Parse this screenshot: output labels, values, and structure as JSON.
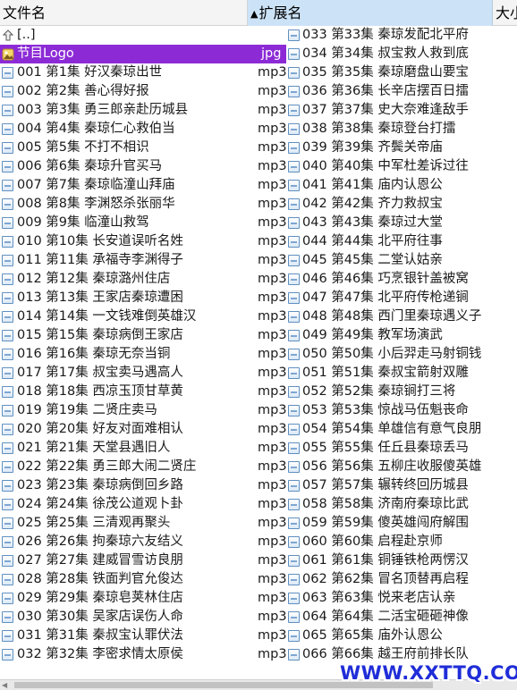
{
  "header": {
    "col_name": "文件名",
    "col_ext": "扩展名",
    "col_size": "大小",
    "sort_indicator": "arrow-up-icon"
  },
  "left_rows": [
    {
      "name": "[..]",
      "ext": "",
      "icon": "up-folder-icon"
    },
    {
      "name": "节目Logo",
      "ext": "jpg",
      "icon": "image-file-icon",
      "selected": true
    },
    {
      "name": "001 第1集 好汉秦琼出世",
      "ext": "mp3",
      "icon": "audio-file-icon"
    },
    {
      "name": "002 第2集 善心得好报",
      "ext": "mp3",
      "icon": "audio-file-icon"
    },
    {
      "name": "003 第3集 勇三郎亲赴历城县",
      "ext": "mp3",
      "icon": "audio-file-icon"
    },
    {
      "name": "004 第4集 秦琼仁心救伯当",
      "ext": "mp3",
      "icon": "audio-file-icon"
    },
    {
      "name": "005 第5集 不打不相识",
      "ext": "mp3",
      "icon": "audio-file-icon"
    },
    {
      "name": "006 第6集 秦琼升官买马",
      "ext": "mp3",
      "icon": "audio-file-icon"
    },
    {
      "name": "007 第7集 秦琼临潼山拜庙",
      "ext": "mp3",
      "icon": "audio-file-icon"
    },
    {
      "name": "008 第8集 李渊怒杀张丽华",
      "ext": "mp3",
      "icon": "audio-file-icon"
    },
    {
      "name": "009 第9集 临潼山救驾",
      "ext": "mp3",
      "icon": "audio-file-icon"
    },
    {
      "name": "010 第10集 长安道误听名姓",
      "ext": "mp3",
      "icon": "audio-file-icon"
    },
    {
      "name": "011 第11集 承福寺李渊得子",
      "ext": "mp3",
      "icon": "audio-file-icon"
    },
    {
      "name": "012 第12集 秦琼潞州住店",
      "ext": "mp3",
      "icon": "audio-file-icon"
    },
    {
      "name": "013 第13集 王家店秦琼遭困",
      "ext": "mp3",
      "icon": "audio-file-icon"
    },
    {
      "name": "014 第14集 一文钱难倒英雄汉",
      "ext": "mp3",
      "icon": "audio-file-icon"
    },
    {
      "name": "015 第15集 秦琼病倒王家店",
      "ext": "mp3",
      "icon": "audio-file-icon"
    },
    {
      "name": "016 第16集 秦琼无奈当铜",
      "ext": "mp3",
      "icon": "audio-file-icon"
    },
    {
      "name": "017 第17集 叔宝卖马遇高人",
      "ext": "mp3",
      "icon": "audio-file-icon"
    },
    {
      "name": "018 第18集 西凉玉顶甘草黄",
      "ext": "mp3",
      "icon": "audio-file-icon"
    },
    {
      "name": "019 第19集 二贤庄卖马",
      "ext": "mp3",
      "icon": "audio-file-icon"
    },
    {
      "name": "020 第20集 好友对面难相认",
      "ext": "mp3",
      "icon": "audio-file-icon"
    },
    {
      "name": "021 第21集 天堂县遇旧人",
      "ext": "mp3",
      "icon": "audio-file-icon"
    },
    {
      "name": "022 第22集 勇三郎大闹二贤庄",
      "ext": "mp3",
      "icon": "audio-file-icon"
    },
    {
      "name": "023 第23集 秦琼病倒回乡路",
      "ext": "mp3",
      "icon": "audio-file-icon"
    },
    {
      "name": "024 第24集 徐茂公道观卜卦",
      "ext": "mp3",
      "icon": "audio-file-icon"
    },
    {
      "name": "025 第25集 三清观再聚头",
      "ext": "mp3",
      "icon": "audio-file-icon"
    },
    {
      "name": "026 第26集 拘秦琼六友结义",
      "ext": "mp3",
      "icon": "audio-file-icon"
    },
    {
      "name": "027 第27集 建威冒雪访良朋",
      "ext": "mp3",
      "icon": "audio-file-icon"
    },
    {
      "name": "028 第28集 铁面判官允俊达",
      "ext": "mp3",
      "icon": "audio-file-icon"
    },
    {
      "name": "029 第29集 秦琼皂荚林住店",
      "ext": "mp3",
      "icon": "audio-file-icon"
    },
    {
      "name": "030 第30集 吴家店误伤人命",
      "ext": "mp3",
      "icon": "audio-file-icon"
    },
    {
      "name": "031 第31集 秦叔宝认罪伏法",
      "ext": "mp3",
      "icon": "audio-file-icon"
    },
    {
      "name": "032 第32集 李密求情太原侯",
      "ext": "mp3",
      "icon": "audio-file-icon"
    }
  ],
  "right_rows": [
    {
      "name": "033 第33集 秦琼发配北平府",
      "icon": "audio-file-icon"
    },
    {
      "name": "034 第34集 叔宝救人救到底",
      "icon": "audio-file-icon"
    },
    {
      "name": "035 第35集 秦琼磨盘山要宝",
      "icon": "audio-file-icon"
    },
    {
      "name": "036 第36集 长辛店摆百日擂",
      "icon": "audio-file-icon"
    },
    {
      "name": "037 第37集 史大奈难逢敌手",
      "icon": "audio-file-icon"
    },
    {
      "name": "038 第38集 秦琼登台打擂",
      "icon": "audio-file-icon"
    },
    {
      "name": "039 第39集 齐鬓关帝庙",
      "icon": "audio-file-icon"
    },
    {
      "name": "040 第40集 中军杜差诉过往",
      "icon": "audio-file-icon"
    },
    {
      "name": "041 第41集 庙内认恩公",
      "icon": "audio-file-icon"
    },
    {
      "name": "042 第42集 齐力救叔宝",
      "icon": "audio-file-icon"
    },
    {
      "name": "043 第43集 秦琼过大堂",
      "icon": "audio-file-icon"
    },
    {
      "name": "044 第44集 北平府往事",
      "icon": "audio-file-icon"
    },
    {
      "name": "045 第45集 二堂认姑亲",
      "icon": "audio-file-icon"
    },
    {
      "name": "046 第46集 巧烹银针盖被窝",
      "icon": "audio-file-icon"
    },
    {
      "name": "047 第47集 北平府传枪递锏",
      "icon": "audio-file-icon"
    },
    {
      "name": "048 第48集 西门里秦琼遇义子",
      "icon": "audio-file-icon"
    },
    {
      "name": "049 第49集 教军场演武",
      "icon": "audio-file-icon"
    },
    {
      "name": "050 第50集 小后羿走马射铜钱",
      "icon": "audio-file-icon"
    },
    {
      "name": "051 第51集 秦叔宝箭射双雕",
      "icon": "audio-file-icon"
    },
    {
      "name": "052 第52集 秦琼锏打三将",
      "icon": "audio-file-icon"
    },
    {
      "name": "053 第53集 惊战马伍魁丧命",
      "icon": "audio-file-icon"
    },
    {
      "name": "054 第54集 单雄信有意气良朋",
      "icon": "audio-file-icon"
    },
    {
      "name": "055 第55集 任丘县秦琼丢马",
      "icon": "audio-file-icon"
    },
    {
      "name": "056 第56集 五柳庄收服傻英雄",
      "icon": "audio-file-icon"
    },
    {
      "name": "057 第57集 辗转终回历城县",
      "icon": "audio-file-icon"
    },
    {
      "name": "058 第58集 济南府秦琼比武",
      "icon": "audio-file-icon"
    },
    {
      "name": "059 第59集 傻英雄闯府解围",
      "icon": "audio-file-icon"
    },
    {
      "name": "060 第60集 启程赴京师",
      "icon": "audio-file-icon"
    },
    {
      "name": "061 第61集 铜锤铁枪两愣汉",
      "icon": "audio-file-icon"
    },
    {
      "name": "062 第62集 冒名顶替再启程",
      "icon": "audio-file-icon"
    },
    {
      "name": "063 第63集 悦来老店认亲",
      "icon": "audio-file-icon"
    },
    {
      "name": "064 第64集 二活宝砸砸神像",
      "icon": "audio-file-icon"
    },
    {
      "name": "065 第65集 庙外认恩公",
      "icon": "audio-file-icon"
    },
    {
      "name": "066 第66集 越王府前排长队",
      "icon": "audio-file-icon"
    }
  ],
  "watermark": "WWW.XXTTQ.COM",
  "colors": {
    "selected_bg": "#8c2bd6",
    "header_active_bg": "#cce3f7",
    "icon_blue": "#5f8fc0",
    "watermark": "#1f2dd8"
  }
}
